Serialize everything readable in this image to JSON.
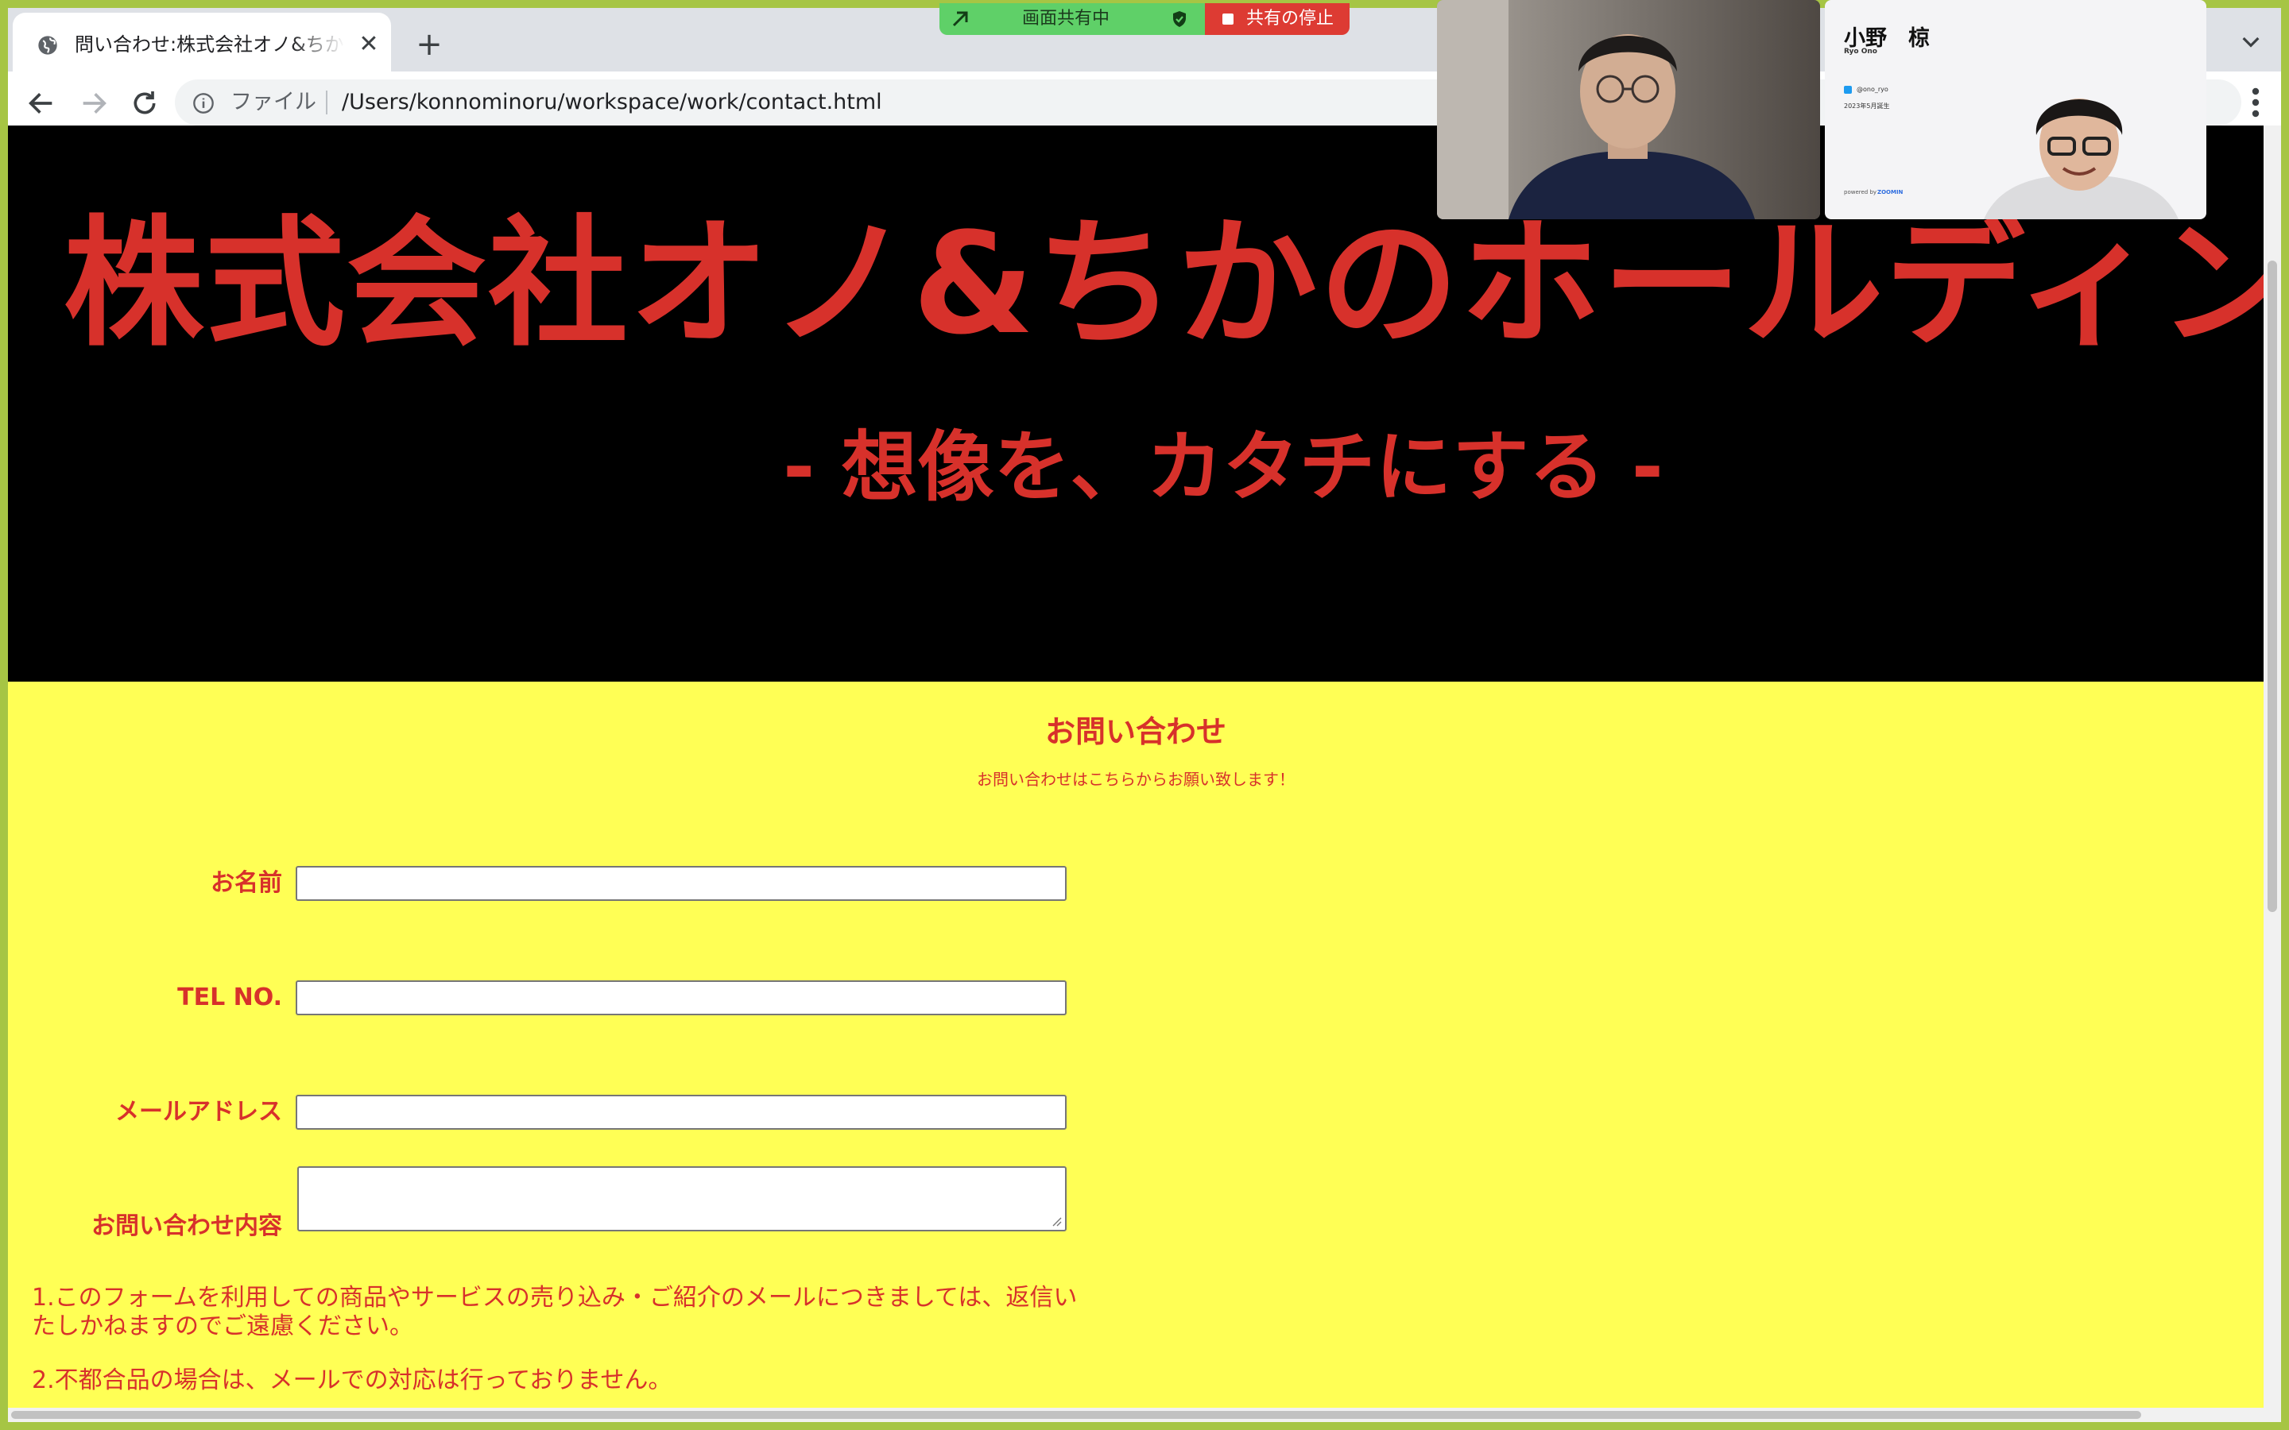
{
  "browser": {
    "tab": {
      "title": "問い合わせ:株式会社オノ&ちかのホールディングス",
      "close_glyph": "✕",
      "icon": "globe-icon"
    },
    "new_tab_glyph": "+",
    "toolbar": {
      "back_icon": "back-arrow-icon",
      "forward_icon": "forward-arrow-icon",
      "reload_icon": "reload-icon",
      "site_info_icon": "info-icon",
      "file_label": "ファイル",
      "url": "/Users/konnominoru/workspace/work/contact.html",
      "menu_icon": "more-vert-icon"
    }
  },
  "page": {
    "hero": {
      "title": "株式会社オノ&ちかのホールディングス",
      "tagline": "- 想像を、カタチにする -"
    },
    "contact": {
      "title": "お問い合わせ",
      "subtitle": "お問い合わせはこちらからお願い致します！",
      "fields": [
        {
          "label": "お名前",
          "value": ""
        },
        {
          "label": "TEL NO.",
          "value": ""
        },
        {
          "label": "メールアドレス",
          "value": ""
        },
        {
          "label": "お問い合わせ内容",
          "value": ""
        }
      ],
      "notes": [
        "1.このフォームを利用しての商品やサービスの売り込み・ご紹介のメールにつきましては、返信いたしかねますのでご遠慮ください。",
        "2.不都合品の場合は、メールでの対応は行っておりません。"
      ]
    }
  },
  "zoom": {
    "sharing_label": "画面共有中",
    "stop_label": "共有の停止",
    "colors": {
      "sharing": "#5fd068",
      "stop": "#dd3b33"
    },
    "participant_slide": {
      "name": "小野　椋",
      "romaji": "Ryo Ono",
      "handle": "@ono_ryo",
      "year": "2023年5月誕生",
      "brand": "powered by",
      "brand_logo": "ZOOMIN"
    }
  },
  "colors": {
    "hero_bg": "#000000",
    "accent_red": "#d7312b",
    "contact_bg": "#ffff55"
  }
}
